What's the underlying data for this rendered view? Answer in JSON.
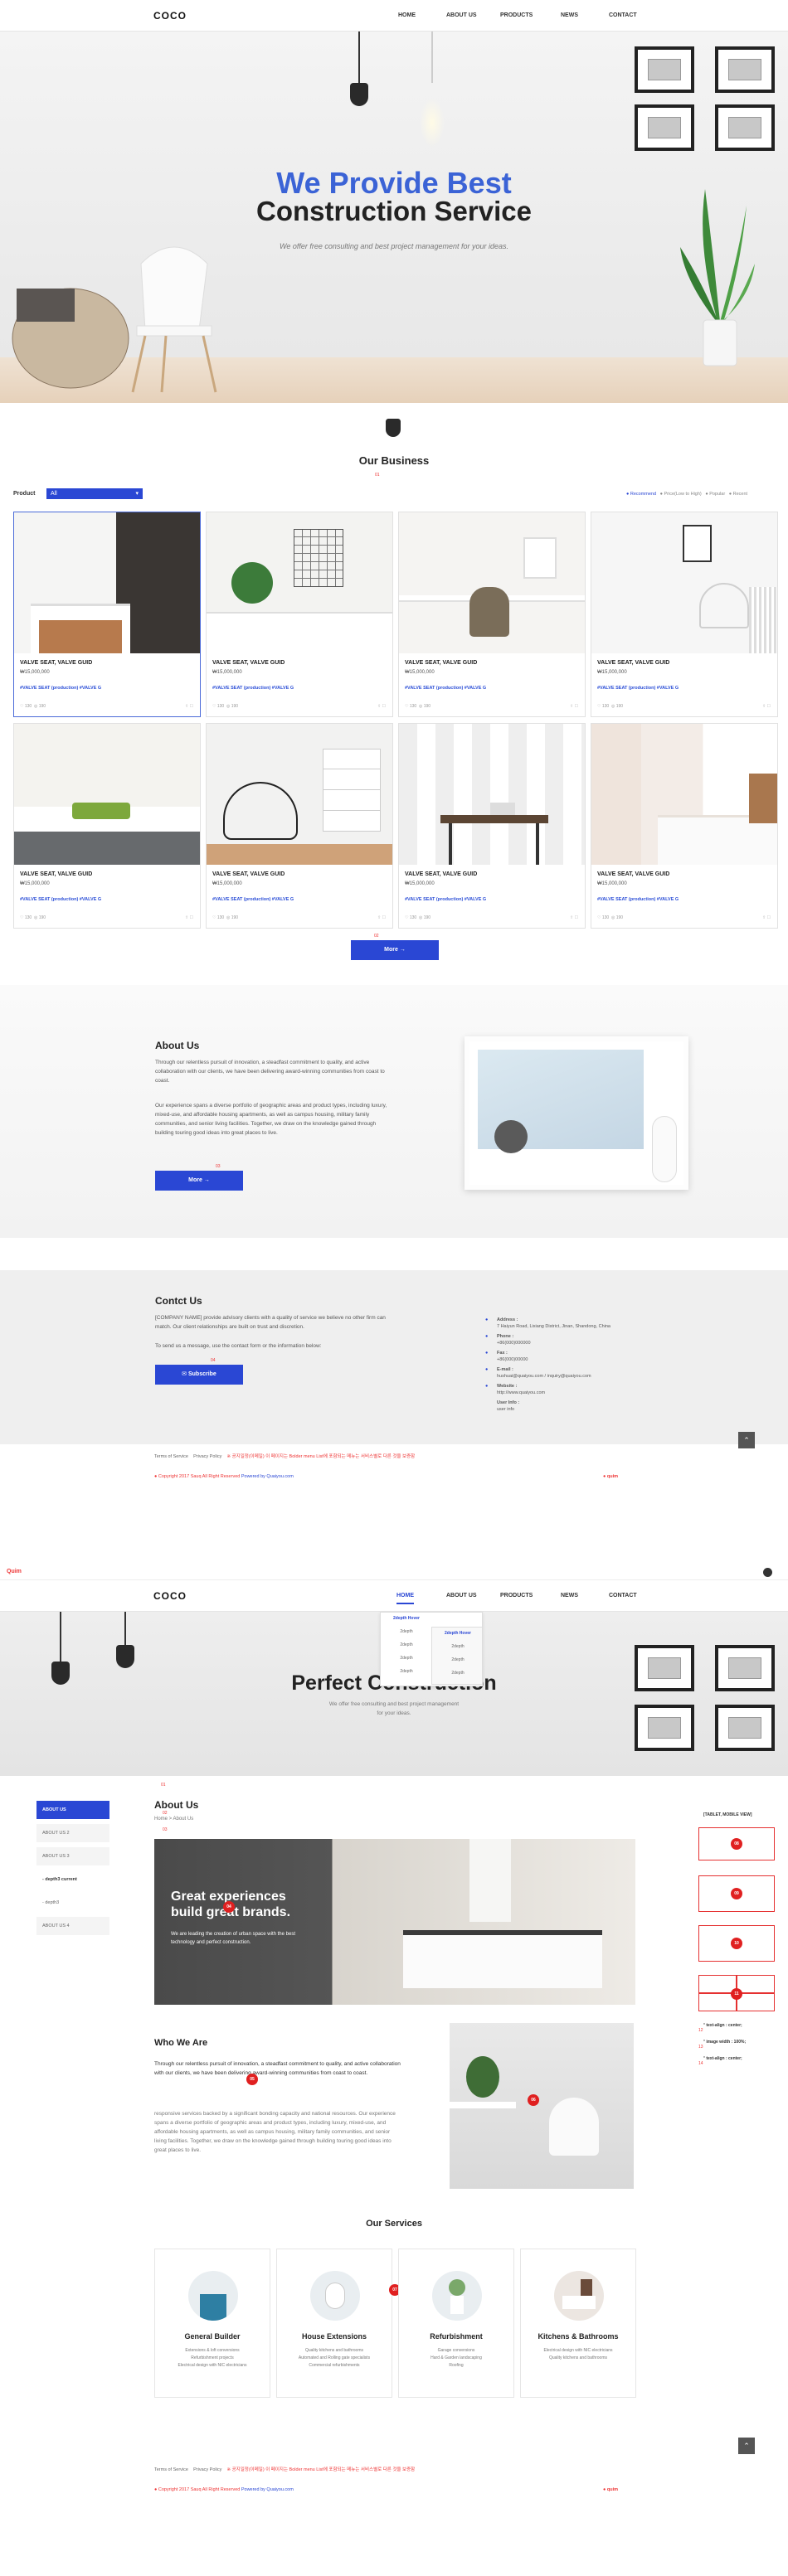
{
  "page1": {
    "header": {
      "logo": "COCO",
      "nav": [
        "HOME",
        "ABOUT US",
        "PRODUCTS",
        "NEWS",
        "CONTACT"
      ]
    },
    "hero": {
      "title_line1": "We Provide Best",
      "title_line2": "Construction Service",
      "subtitle": "We offer free consulting and best project management for your ideas."
    },
    "business": {
      "title": "Our Business",
      "marker": "01",
      "filter_label": "Product",
      "filter_value": "All",
      "sort_options": [
        "Recommend",
        "Price(Low to High)",
        "Popular",
        "Recent"
      ],
      "products": [
        {
          "title": "VALVE SEAT, VALVE GUID",
          "price": "₩15,000,000",
          "tags": "#VALVE SEAT (production)   #VALVE G",
          "likes": "130",
          "views": "190"
        },
        {
          "title": "VALVE SEAT, VALVE GUID",
          "price": "₩15,000,000",
          "tags": "#VALVE SEAT (production)   #VALVE G",
          "likes": "130",
          "views": "190"
        },
        {
          "title": "VALVE SEAT, VALVE GUID",
          "price": "₩15,000,000",
          "tags": "#VALVE SEAT (production)   #VALVE G",
          "likes": "130",
          "views": "190"
        },
        {
          "title": "VALVE SEAT, VALVE GUID",
          "price": "₩15,000,000",
          "tags": "#VALVE SEAT (production)   #VALVE G",
          "likes": "130",
          "views": "190"
        },
        {
          "title": "VALVE SEAT, VALVE GUID",
          "price": "₩15,000,000",
          "tags": "#VALVE SEAT (production)   #VALVE G",
          "likes": "130",
          "views": "190"
        },
        {
          "title": "VALVE SEAT, VALVE GUID",
          "price": "₩15,000,000",
          "tags": "#VALVE SEAT (production)   #VALVE G",
          "likes": "130",
          "views": "190"
        },
        {
          "title": "VALVE SEAT, VALVE GUID",
          "price": "₩15,000,000",
          "tags": "#VALVE SEAT (production)   #VALVE G",
          "likes": "130",
          "views": "190"
        },
        {
          "title": "VALVE SEAT, VALVE GUID",
          "price": "₩15,000,000",
          "tags": "#VALVE SEAT (production)   #VALVE G",
          "likes": "130",
          "views": "190"
        }
      ],
      "more_button": "More",
      "marker2": "02"
    },
    "about": {
      "title": "About Us",
      "p1": "Through our relentless pursuit of innovation, a steadfast commitment to quality, and active collaboration with our clients, we have been delivering award-winning communities from coast to coast.",
      "p2": "Our experience spans a diverse portfolio of geographic areas and product types, including luxury, mixed-use, and affordable housing apartments, as well as campus housing, military family communities, and senior living facilities. Together, we draw on the knowledge gained through building touring good ideas into great places to live.",
      "more_button": "More",
      "marker": "03"
    },
    "contact": {
      "title": "Contct Us",
      "p1": "[COMPANY NAME] provide advisory clients with a quality of service we believe no other firm can match. Our client relationships are built on trust and discretion.",
      "p2": "To send us a message, use the contact form or the information below:",
      "subscribe": "Subscribe",
      "marker": "04",
      "address_label": "Address :",
      "address": "7 Haiyun Road, Lixiang District, Jinan, Shandong, China",
      "phone_label": "Phone :",
      "phone": "+86(000)000000",
      "fax_label": "Fax :",
      "fax": "+86(000)00000",
      "email_label": "E-mail :",
      "email": "hushuai@quaiyou.com / inquiry@quaiyou.com",
      "website_label": "Website :",
      "website": "http://www.quaiyou.com",
      "userinfo_label": "User Info :",
      "userinfo": "user info"
    },
    "footer": {
      "terms": "Terms of Service",
      "privacy": "Privacy Policy",
      "note": "※ 공지일정(이메일) 이 페이지는 Bolder menu List에 포함되는 메뉴는 서비스별로 다른 것을 보증함",
      "copyright": "Copyright 2017 Sauq All Right Reserved",
      "powered": "Powered by Quaiyou.com",
      "brand_small": "quim"
    }
  },
  "page2": {
    "topbar_brand": "Quim",
    "header": {
      "logo": "COCO",
      "nav": [
        "HOME",
        "ABOUT US",
        "PRODUCTS",
        "NEWS",
        "CONTACT"
      ],
      "dropdown_col1": [
        "2depth Hover",
        "2depth",
        "2depth",
        "2depth",
        "2depth"
      ],
      "dropdown_col2": [
        "2depth Hover",
        "2depth",
        "2depth",
        "2depth"
      ]
    },
    "hero": {
      "title": "Perfect Construction",
      "subtitle": "We offer free consulting and best project management for your ideas."
    },
    "sidebar": [
      "ABOUT US",
      "ABOUT US 2",
      "ABOUT US 3",
      "- depth3 current",
      "- depth3",
      "ABOUT US 4"
    ],
    "breadcrumb": "Home > About Us",
    "page_title": "About Us",
    "banner": {
      "title": "Great experiences build great brands.",
      "text": "We are leading the creation of urban space with the best technology and perfect construction."
    },
    "who": {
      "title": "Who We Are",
      "p1": "Through our relentless pursuit of innovation, a steadfast commitment to quality, and active collaboration with our clients, we have been delivering award-winning communities from coast to coast.",
      "p2": "responsive services backed by a significant bonding capacity and national resources. Our experience spans a diverse portfolio of geographic areas and product types, including luxury, mixed-use, and affordable housing apartments, as well as campus housing, military family communities, and senior living facilities. Together, we draw on the knowledge gained through building touring good ideas into great places to live."
    },
    "services": {
      "title": "Our Services",
      "items": [
        {
          "name": "General Builder",
          "lines": [
            "Extensions & loft conversions",
            "Refurbishment projects",
            "Electrical design with NIC electricians"
          ]
        },
        {
          "name": "House Extensions",
          "lines": [
            "Quality kitchens and bathrooms",
            "Automated and Rolling gate specialists",
            "Commercial refurbishments"
          ]
        },
        {
          "name": "Refurbishment",
          "lines": [
            "Garage conversions",
            "Hard & Garden landscaping",
            "Roofing"
          ]
        },
        {
          "name": "Kitchens & Bathrooms",
          "lines": [
            "Electrical design with NIC electricians",
            "Quality kitchens and bathrooms"
          ]
        }
      ]
    },
    "right_notes": {
      "title": "[TABLET, MOBILE VIEW]",
      "code1": "text-align : center;",
      "code2": "image width : 100%;",
      "code3": "text-align : center;"
    },
    "markers": [
      "01",
      "02",
      "03",
      "04",
      "05",
      "06",
      "07",
      "08",
      "09",
      "10",
      "11",
      "12",
      "13",
      "14"
    ],
    "footer": {
      "terms": "Terms of Service",
      "privacy": "Privacy Policy",
      "note": "※ 공지일정(이메일) 이 페이지는 Bolder menu List에 포함되는 메뉴는 서비스별로 다른 것을 보증함",
      "copyright": "Copyright 2017 Sauq All Right Reserved",
      "powered": "Powered by Quaiyou.com",
      "brand_small": "quim"
    }
  },
  "colors": {
    "accent": "#2a47d4",
    "hero_blue": "#3b63d6",
    "red_marker": "#e02020"
  }
}
